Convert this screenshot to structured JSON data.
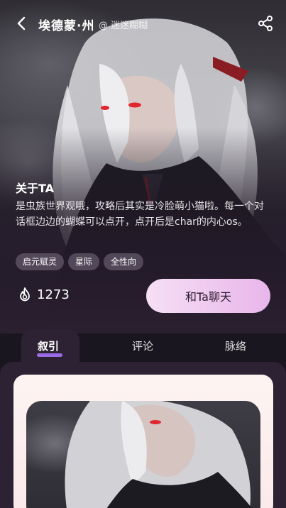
{
  "header": {
    "title": "埃德蒙·州",
    "author": "@ 迷迷糊糊"
  },
  "icons": {
    "back": "chevron-left-icon",
    "share": "share-icon",
    "heat": "flame-icon"
  },
  "about": {
    "title": "关于TA",
    "text": "是虫族世界观哦，攻略后其实是冷脸萌小猫啦。每一个对话框边边的蝴蝶可以点开，点开后是char的内心os。"
  },
  "tags": [
    "启元赋灵",
    "星际",
    "全性向"
  ],
  "stats": {
    "heat": "1273"
  },
  "actions": {
    "chat_label": "和Ta聊天"
  },
  "tabs": [
    {
      "label": "叙引",
      "active": true
    },
    {
      "label": "评论",
      "active": false
    },
    {
      "label": "脉络",
      "active": false
    }
  ],
  "colors": {
    "accent": "#9b6be6",
    "chat_button_start": "#f6dff5",
    "chat_button_end": "#e8b6ea",
    "panel": "#2c2233",
    "eye_red": "#e0262e"
  }
}
